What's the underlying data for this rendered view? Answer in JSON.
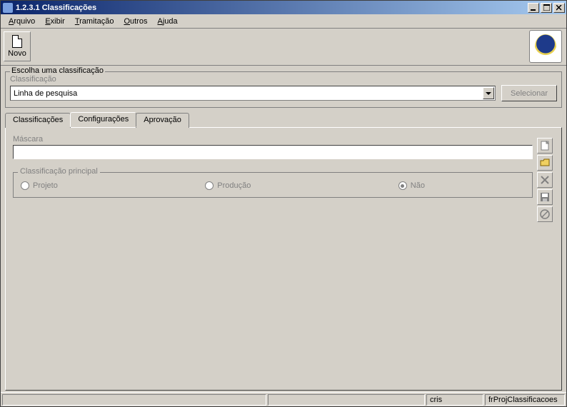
{
  "window": {
    "title": "1.2.3.1 Classificações"
  },
  "menu": {
    "arquivo": "Arquivo",
    "exibir": "Exibir",
    "tramitacao": "Tramitação",
    "outros": "Outros",
    "ajuda": "Ajuda"
  },
  "toolbar": {
    "novo": "Novo"
  },
  "group": {
    "legend": "Escolha uma classificação",
    "label": "Classificação",
    "value": "Linha de pesquisa",
    "selecionar": "Selecionar"
  },
  "tabs": {
    "classificacoes": "Classificações",
    "configuracoes": "Configurações",
    "aprovacao": "Aprovação"
  },
  "config": {
    "mascara_label": "Máscara",
    "mascara_value": "",
    "principal_legend": "Classificação principal",
    "radios": {
      "projeto": "Projeto",
      "producao": "Produção",
      "nao": "Não"
    }
  },
  "statusbar": {
    "user": "cris",
    "form": "frProjClassificacoes"
  }
}
